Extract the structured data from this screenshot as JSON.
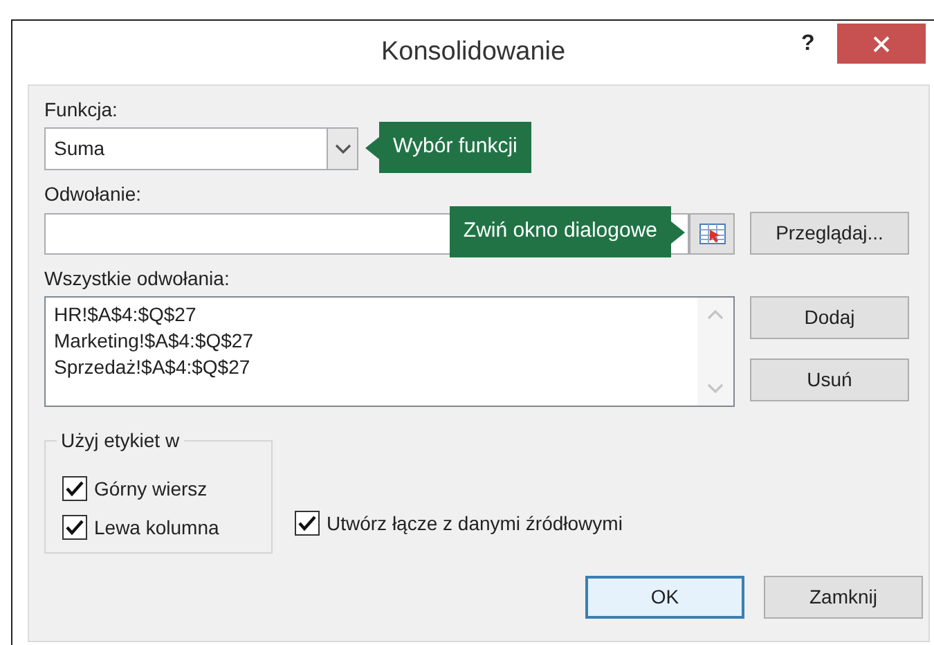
{
  "window": {
    "title": "Konsolidowanie",
    "help": "?"
  },
  "function": {
    "label": "Funkcja:",
    "value": "Suma",
    "tooltip": "Wybór funkcji"
  },
  "reference": {
    "label": "Odwołanie:",
    "tooltip": "Zwiń okno dialogowe"
  },
  "browse_button": {
    "label": "Przeglądaj..."
  },
  "all_references": {
    "label": "Wszystkie odwołania:",
    "items": [
      "HR!$A$4:$Q$27",
      "Marketing!$A$4:$Q$27",
      "Sprzedaż!$A$4:$Q$27"
    ]
  },
  "side_buttons": [
    {
      "label": "Dodaj"
    },
    {
      "label": "Usuń"
    }
  ],
  "labels_group": {
    "legend": "Użyj etykiet w",
    "options": [
      {
        "label": "Górny wiersz",
        "checked": true
      },
      {
        "label": "Lewa kolumna",
        "checked": true
      }
    ]
  },
  "link_option": {
    "label": "Utwórz łącze z danymi źródłowymi",
    "checked": true
  },
  "buttons": [
    {
      "label": "OK",
      "default": true
    },
    {
      "label": "Zamknij",
      "default": false
    }
  ]
}
